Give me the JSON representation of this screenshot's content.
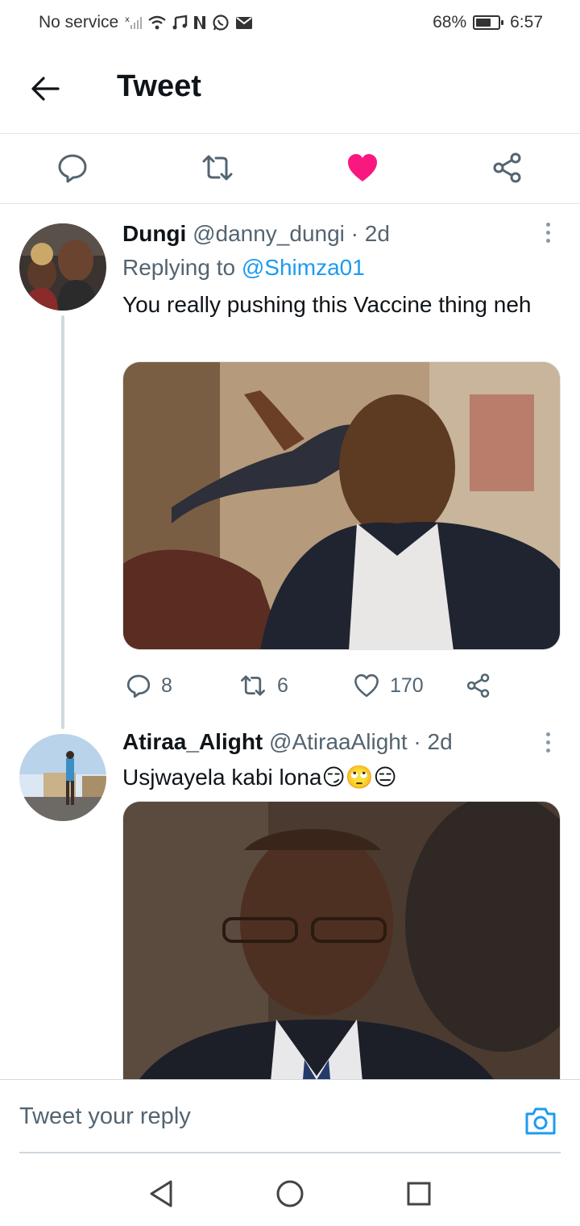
{
  "status_bar": {
    "carrier": "No service",
    "battery_percent": "68%",
    "battery_level": 0.68,
    "time": "6:57",
    "icons": [
      "signal-icon",
      "wifi-icon",
      "music-icon",
      "netflix-icon",
      "whatsapp-icon",
      "mail-icon"
    ]
  },
  "header": {
    "title": "Tweet"
  },
  "action_bar": {
    "liked": true,
    "like_color": "#f91880",
    "icons": [
      "reply-icon",
      "retweet-icon",
      "heart-icon",
      "share-icon"
    ]
  },
  "tweets": [
    {
      "name": "Dungi",
      "handle": "@danny_dungi",
      "separator": "·",
      "time": "2d",
      "replying_label": "Replying to",
      "replying_to": "@Shimza01",
      "text": "You really pushing this Vaccine thing neh",
      "replies": "8",
      "retweets": "6",
      "likes": "170"
    },
    {
      "name": "Atiraa_Alight",
      "handle": "@AtiraaAlight",
      "separator": "·",
      "time": "2d",
      "text": "Usjwayela kabi lona😏🙄😑"
    }
  ],
  "composer": {
    "placeholder": "Tweet your reply"
  },
  "colors": {
    "accent": "#1d9bf0",
    "text": "#0f1419",
    "secondary": "#536471",
    "divider": "#e1e4e6"
  }
}
